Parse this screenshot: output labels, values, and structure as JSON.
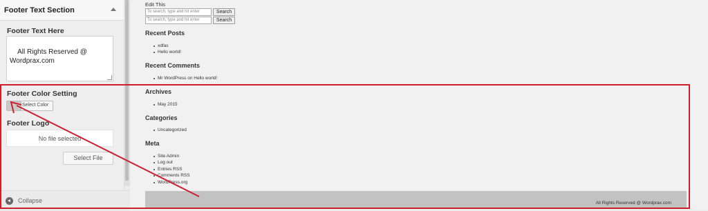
{
  "panel": {
    "section_title": "Footer Text Section",
    "footer_text_label": "Footer Text Here",
    "footer_text_value": "All Rights Reserved @ Wordprax.com",
    "color_label": "Footer Color Setting",
    "select_color": "Select Color",
    "logo_label": "Footer Logo",
    "no_file": "No file selected",
    "select_file": "Select File",
    "collapse": "Collapse",
    "swatch_color": "#c9c9c9"
  },
  "preview": {
    "edit_link": "Edit This",
    "search": {
      "placeholder": "To search, type and hit enter",
      "button": "Search"
    },
    "widgets": {
      "recent_posts": {
        "title": "Recent Posts",
        "items": [
          "xdfas",
          "Hello world!"
        ]
      },
      "recent_comments": {
        "title": "Recent Comments",
        "items": [
          "Mr WordPress on Hello world!"
        ]
      },
      "archives": {
        "title": "Archives",
        "items": [
          "May 2015"
        ]
      },
      "categories": {
        "title": "Categories",
        "items": [
          "Uncategorized"
        ]
      },
      "meta": {
        "title": "Meta",
        "items": [
          "Site Admin",
          "Log out",
          "Entries RSS",
          "Comments RSS",
          "WordPress.org"
        ]
      }
    },
    "footer_text": "All Rights Reserved @ Wordprax.com",
    "footer_color": "#c2c2c2"
  },
  "annotation": {
    "color": "#cc1f2a"
  }
}
